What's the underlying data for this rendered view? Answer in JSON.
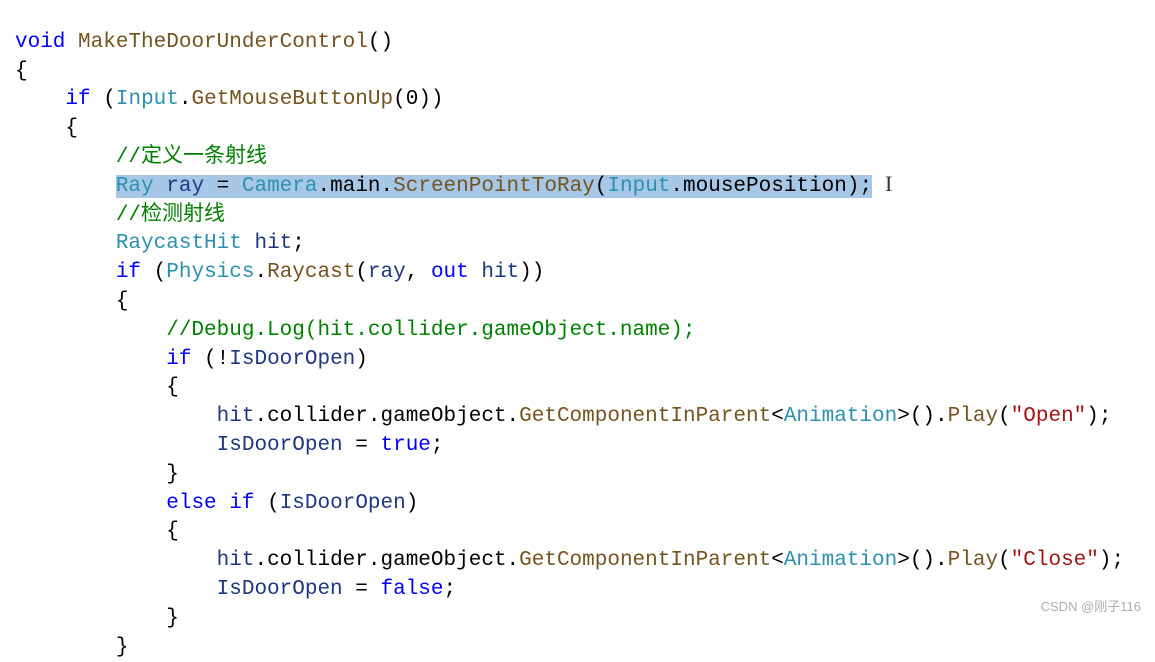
{
  "code": {
    "l1": {
      "void": "void",
      "method": "MakeTheDoorUnderControl",
      "p": "()"
    },
    "l2": "{",
    "l3": {
      "if": "if",
      "p1": " (",
      "Input": "Input",
      "dot": ".",
      "GetMBU": "GetMouseButtonUp",
      "arg": "(0))"
    },
    "l4": "    {",
    "l5": "        //定义一条射线",
    "l6": {
      "indent": "        ",
      "Ray": "Ray",
      "sp1": " ",
      "rayv": "ray",
      "eq": " = ",
      "Camera": "Camera",
      "d1": ".",
      "main": "main",
      "d2": ".",
      "SPTR": "ScreenPointToRay",
      "p1": "(",
      "Input": "Input",
      "d3": ".",
      "mp": "mousePosition",
      "p2": ");"
    },
    "l7": "        //检测射线",
    "l8": {
      "indent": "        ",
      "RH": "RaycastHit",
      "sp": " ",
      "hit": "hit",
      "semi": ";"
    },
    "l9": {
      "indent": "        ",
      "if": "if",
      "p1": " (",
      "Physics": "Physics",
      "d1": ".",
      "Raycast": "Raycast",
      "p2": "(",
      "ray": "ray",
      "c": ", ",
      "out": "out",
      "sp": " ",
      "hit": "hit",
      "p3": "))"
    },
    "l10": "        {",
    "l11": "            //Debug.Log(hit.collider.gameObject.name);",
    "l12": {
      "indent": "            ",
      "if": "if",
      "p1": " (!",
      "IDO": "IsDoorOpen",
      "p2": ")"
    },
    "l13": "            {",
    "l14": {
      "indent": "                ",
      "hit": "hit",
      "d1": ".",
      "coll": "collider",
      "d2": ".",
      "go": "gameObject",
      "d3": ".",
      "GCIP": "GetComponentInParent",
      "lt": "<",
      "Anim": "Animation",
      "gt": ">",
      "pp": "().",
      "Play": "Play",
      "p1": "(",
      "str": "\"Open\"",
      "p2": ");"
    },
    "l15": {
      "indent": "                ",
      "IDO": "IsDoorOpen",
      "eq": " = ",
      "true": "true",
      "semi": ";"
    },
    "l16": "            }",
    "l17": {
      "indent": "            ",
      "else": "else",
      "sp": " ",
      "if": "if",
      "p1": " (",
      "IDO": "IsDoorOpen",
      "p2": ")"
    },
    "l18": "            {",
    "l19": {
      "indent": "                ",
      "hit": "hit",
      "d1": ".",
      "coll": "collider",
      "d2": ".",
      "go": "gameObject",
      "d3": ".",
      "GCIP": "GetComponentInParent",
      "lt": "<",
      "Anim": "Animation",
      "gt": ">",
      "pp": "().",
      "Play": "Play",
      "p1": "(",
      "str": "\"Close\"",
      "p2": ");"
    },
    "l20": {
      "indent": "                ",
      "IDO": "IsDoorOpen",
      "eq": " = ",
      "false": "false",
      "semi": ";"
    },
    "l21": "            }",
    "l22": "        }"
  },
  "watermark": "CSDN @刚子116",
  "cursor": "I"
}
